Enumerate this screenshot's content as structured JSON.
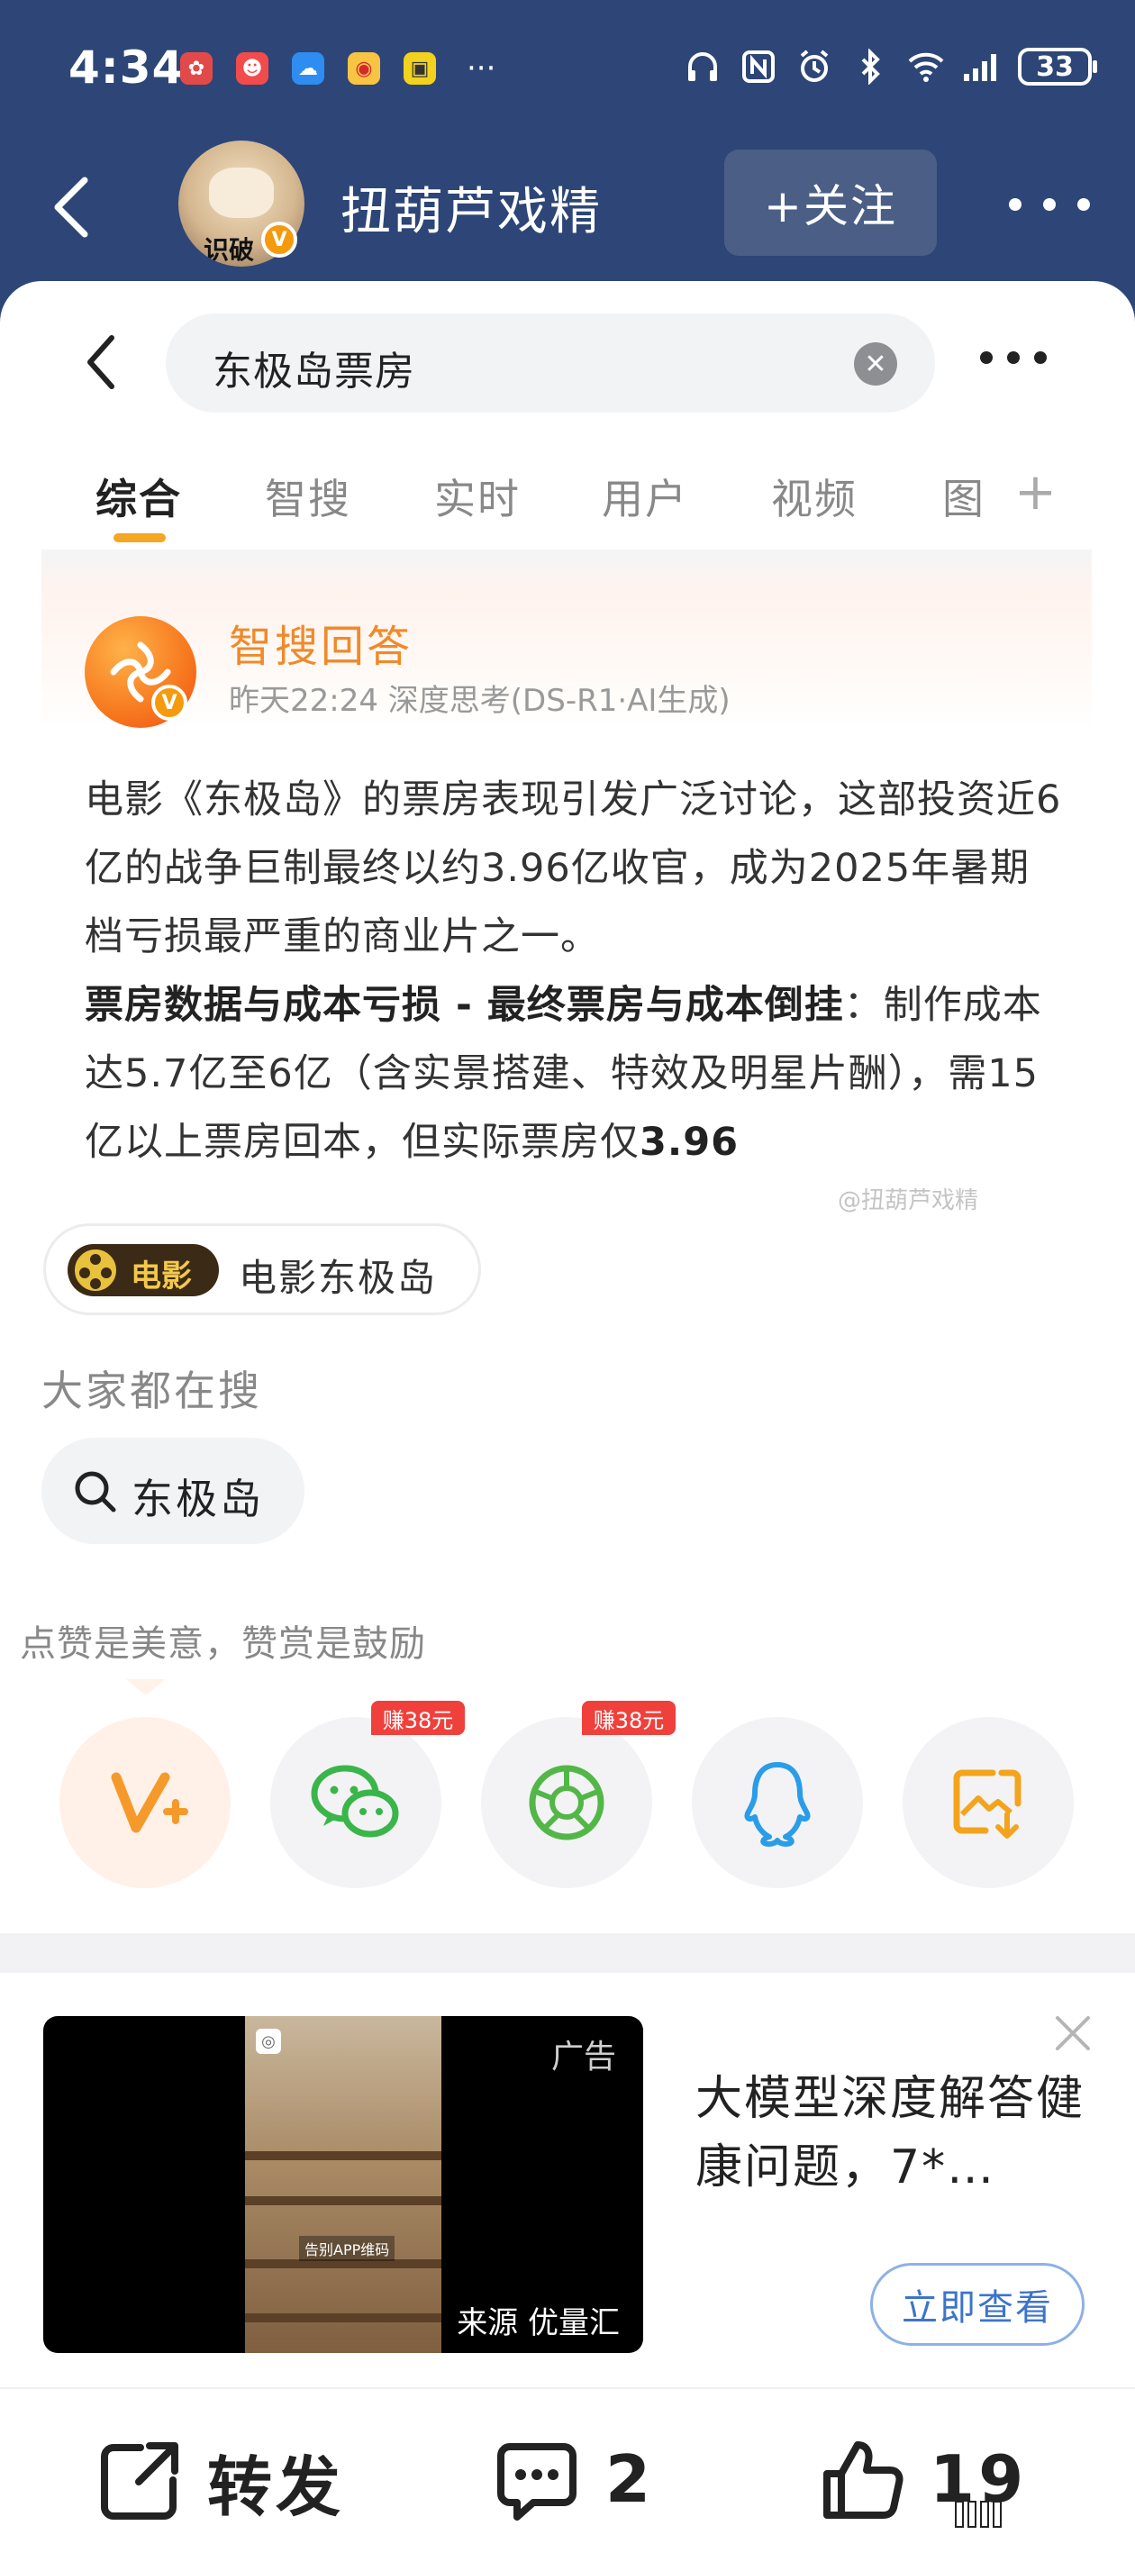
{
  "status_bar": {
    "time": "4:34",
    "battery": "33"
  },
  "header": {
    "username": "扭葫芦戏精",
    "avatar_text": "识破",
    "follow_label": "+关注"
  },
  "search": {
    "query": "东极岛票房"
  },
  "tabs": [
    "综合",
    "智搜",
    "实时",
    "用户",
    "视频",
    "图"
  ],
  "ai_answer": {
    "title": "智搜回答",
    "subtitle": "昨天22:24 深度思考(DS-R1·AI生成)",
    "para1": "电影《东极岛》的票房表现引发广泛讨论，这部投资近6亿的战争巨制最终以约3.96亿收官，成为2025年暑期档亏损最严重的商业片之一。",
    "para2_bold": "票房数据与成本亏损 - 最终票房与成本倒挂",
    "para2_rest": "：制作成本达5.7亿至6亿（含实景搭建、特效及明星片酬），需15亿以上票房回本，但实际票房仅",
    "para2_end": "3.96",
    "watermark": "@扭葫芦戏精"
  },
  "movie_tag": {
    "badge": "电影",
    "label": "电影东极岛"
  },
  "hot_search": {
    "title": "大家都在搜",
    "chip": "东极岛"
  },
  "like_hint": "点赞是美意，赞赏是鼓励",
  "share": {
    "items": [
      {
        "name": "vip",
        "earn": ""
      },
      {
        "name": "wechat",
        "earn": "赚38元"
      },
      {
        "name": "moments",
        "earn": "赚38元"
      },
      {
        "name": "qq",
        "earn": ""
      },
      {
        "name": "save-image",
        "earn": ""
      }
    ]
  },
  "ad": {
    "tag": "广告",
    "source": "来源 优量汇",
    "video_caption": "告别APP维码",
    "title": "大模型深度解答健康问题，7*…",
    "cta": "立即查看"
  },
  "bottom_bar": {
    "repost": "转发",
    "comments": "2",
    "likes": "19"
  },
  "colors": {
    "header_bg": "#2d4677",
    "accent": "#f5a623",
    "ai_title": "#ef8a2a",
    "cta": "#3d74c9",
    "earn": "#f0403c"
  }
}
